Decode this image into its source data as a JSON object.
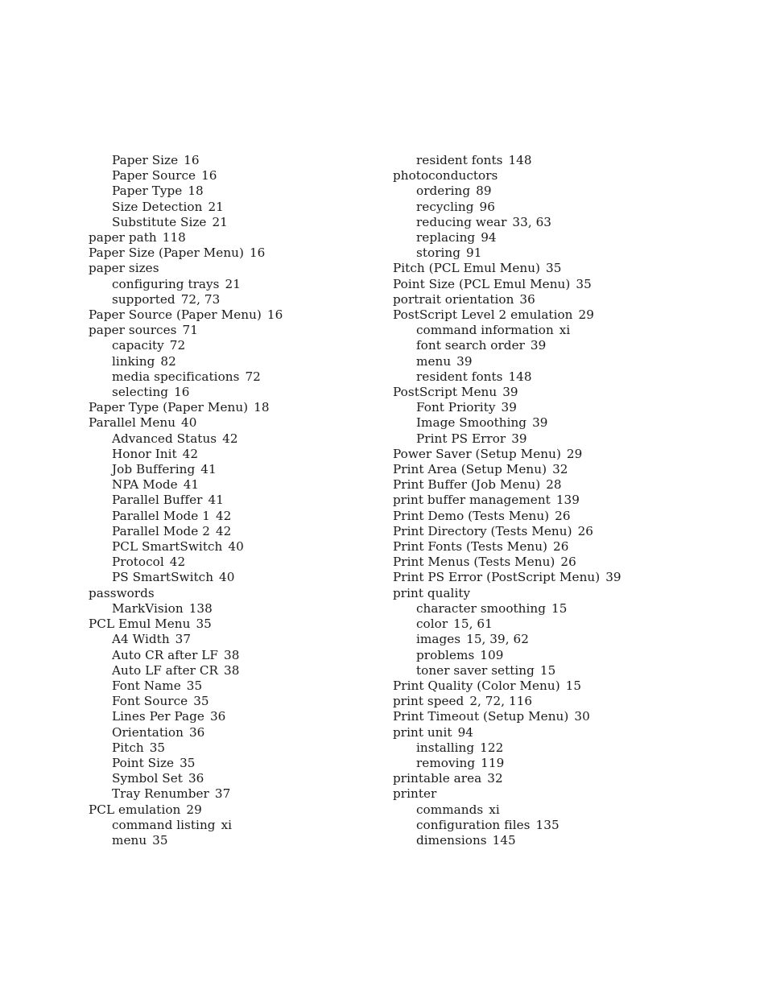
{
  "document": {
    "type": "book-index",
    "page_background": "#ffffff",
    "text_color": "#1a1a1a"
  },
  "columns": [
    {
      "name": "left-column",
      "entries": [
        {
          "level": 1,
          "term": "Paper Size",
          "pages": "16"
        },
        {
          "level": 1,
          "term": "Paper Source",
          "pages": "16"
        },
        {
          "level": 1,
          "term": "Paper Type",
          "pages": "18"
        },
        {
          "level": 1,
          "term": "Size Detection",
          "pages": "21"
        },
        {
          "level": 1,
          "term": "Substitute Size",
          "pages": "21"
        },
        {
          "level": 0,
          "term": "paper path",
          "pages": "118"
        },
        {
          "level": 0,
          "term": "Paper Size (Paper Menu)",
          "pages": "16"
        },
        {
          "level": 0,
          "term": "paper sizes",
          "pages": ""
        },
        {
          "level": 1,
          "term": "configuring trays",
          "pages": "21"
        },
        {
          "level": 1,
          "term": "supported",
          "pages": "72, 73"
        },
        {
          "level": 0,
          "term": "Paper Source (Paper Menu)",
          "pages": "16"
        },
        {
          "level": 0,
          "term": "paper sources",
          "pages": "71"
        },
        {
          "level": 1,
          "term": "capacity",
          "pages": "72"
        },
        {
          "level": 1,
          "term": "linking",
          "pages": "82"
        },
        {
          "level": 1,
          "term": "media specifications",
          "pages": "72"
        },
        {
          "level": 1,
          "term": "selecting",
          "pages": "16"
        },
        {
          "level": 0,
          "term": "Paper Type (Paper Menu)",
          "pages": "18"
        },
        {
          "level": 0,
          "term": "Parallel Menu",
          "pages": "40"
        },
        {
          "level": 1,
          "term": "Advanced Status",
          "pages": "42"
        },
        {
          "level": 1,
          "term": "Honor Init",
          "pages": "42"
        },
        {
          "level": 1,
          "term": "Job Buffering",
          "pages": "41"
        },
        {
          "level": 1,
          "term": "NPA Mode",
          "pages": "41"
        },
        {
          "level": 1,
          "term": "Parallel Buffer",
          "pages": "41"
        },
        {
          "level": 1,
          "term": "Parallel Mode 1",
          "pages": "42"
        },
        {
          "level": 1,
          "term": "Parallel Mode 2",
          "pages": "42"
        },
        {
          "level": 1,
          "term": "PCL SmartSwitch",
          "pages": "40"
        },
        {
          "level": 1,
          "term": "Protocol",
          "pages": "42"
        },
        {
          "level": 1,
          "term": "PS SmartSwitch",
          "pages": "40"
        },
        {
          "level": 0,
          "term": "passwords",
          "pages": ""
        },
        {
          "level": 1,
          "term": "MarkVision",
          "pages": "138"
        },
        {
          "level": 0,
          "term": "PCL Emul Menu",
          "pages": "35"
        },
        {
          "level": 1,
          "term": "A4 Width",
          "pages": "37"
        },
        {
          "level": 1,
          "term": "Auto CR after LF",
          "pages": "38"
        },
        {
          "level": 1,
          "term": "Auto LF after CR",
          "pages": "38"
        },
        {
          "level": 1,
          "term": "Font Name",
          "pages": "35"
        },
        {
          "level": 1,
          "term": "Font Source",
          "pages": "35"
        },
        {
          "level": 1,
          "term": "Lines Per Page",
          "pages": "36"
        },
        {
          "level": 1,
          "term": "Orientation",
          "pages": "36"
        },
        {
          "level": 1,
          "term": "Pitch",
          "pages": "35"
        },
        {
          "level": 1,
          "term": "Point Size",
          "pages": "35"
        },
        {
          "level": 1,
          "term": "Symbol Set",
          "pages": "36"
        },
        {
          "level": 1,
          "term": "Tray Renumber",
          "pages": "37"
        },
        {
          "level": 0,
          "term": "PCL emulation",
          "pages": "29"
        },
        {
          "level": 1,
          "term": "command listing",
          "pages": "xi"
        },
        {
          "level": 1,
          "term": "menu",
          "pages": "35"
        }
      ]
    },
    {
      "name": "right-column",
      "entries": [
        {
          "level": 1,
          "term": "resident fonts",
          "pages": "148"
        },
        {
          "level": 0,
          "term": "photoconductors",
          "pages": ""
        },
        {
          "level": 1,
          "term": "ordering",
          "pages": "89"
        },
        {
          "level": 1,
          "term": "recycling",
          "pages": "96"
        },
        {
          "level": 1,
          "term": "reducing wear",
          "pages": "33, 63"
        },
        {
          "level": 1,
          "term": "replacing",
          "pages": "94"
        },
        {
          "level": 1,
          "term": "storing",
          "pages": "91"
        },
        {
          "level": 0,
          "term": "Pitch (PCL Emul Menu)",
          "pages": "35"
        },
        {
          "level": 0,
          "term": "Point Size (PCL Emul Menu)",
          "pages": "35"
        },
        {
          "level": 0,
          "term": "portrait orientation",
          "pages": "36"
        },
        {
          "level": 0,
          "term": "PostScript Level 2 emulation",
          "pages": "29"
        },
        {
          "level": 1,
          "term": "command information",
          "pages": "xi"
        },
        {
          "level": 1,
          "term": "font search order",
          "pages": "39"
        },
        {
          "level": 1,
          "term": "menu",
          "pages": "39"
        },
        {
          "level": 1,
          "term": "resident fonts",
          "pages": "148"
        },
        {
          "level": 0,
          "term": "PostScript Menu",
          "pages": "39"
        },
        {
          "level": 1,
          "term": "Font Priority",
          "pages": "39"
        },
        {
          "level": 1,
          "term": "Image Smoothing",
          "pages": "39"
        },
        {
          "level": 1,
          "term": "Print PS Error",
          "pages": "39"
        },
        {
          "level": 0,
          "term": "Power Saver (Setup Menu)",
          "pages": "29"
        },
        {
          "level": 0,
          "term": "Print Area (Setup Menu)",
          "pages": "32"
        },
        {
          "level": 0,
          "term": "Print Buffer (Job Menu)",
          "pages": "28"
        },
        {
          "level": 0,
          "term": "print buffer management",
          "pages": "139"
        },
        {
          "level": 0,
          "term": "Print Demo (Tests Menu)",
          "pages": "26"
        },
        {
          "level": 0,
          "term": "Print Directory (Tests Menu)",
          "pages": "26"
        },
        {
          "level": 0,
          "term": "Print Fonts (Tests Menu)",
          "pages": "26"
        },
        {
          "level": 0,
          "term": "Print Menus (Tests Menu)",
          "pages": "26"
        },
        {
          "level": 0,
          "term": "Print PS Error (PostScript Menu)",
          "pages": "39"
        },
        {
          "level": 0,
          "term": "print quality",
          "pages": ""
        },
        {
          "level": 1,
          "term": "character smoothing",
          "pages": "15"
        },
        {
          "level": 1,
          "term": "color",
          "pages": "15, 61"
        },
        {
          "level": 1,
          "term": "images",
          "pages": "15, 39, 62"
        },
        {
          "level": 1,
          "term": "problems",
          "pages": "109"
        },
        {
          "level": 1,
          "term": "toner saver setting",
          "pages": "15"
        },
        {
          "level": 0,
          "term": "Print Quality (Color Menu)",
          "pages": "15"
        },
        {
          "level": 0,
          "term": "print speed",
          "pages": "2, 72, 116"
        },
        {
          "level": 0,
          "term": "Print Timeout (Setup Menu)",
          "pages": "30"
        },
        {
          "level": 0,
          "term": "print unit",
          "pages": "94"
        },
        {
          "level": 1,
          "term": "installing",
          "pages": "122"
        },
        {
          "level": 1,
          "term": "removing",
          "pages": "119"
        },
        {
          "level": 0,
          "term": "printable area",
          "pages": "32"
        },
        {
          "level": 0,
          "term": "printer",
          "pages": ""
        },
        {
          "level": 1,
          "term": "commands",
          "pages": "xi"
        },
        {
          "level": 1,
          "term": "configuration files",
          "pages": "135"
        },
        {
          "level": 1,
          "term": "dimensions",
          "pages": "145"
        }
      ]
    }
  ]
}
